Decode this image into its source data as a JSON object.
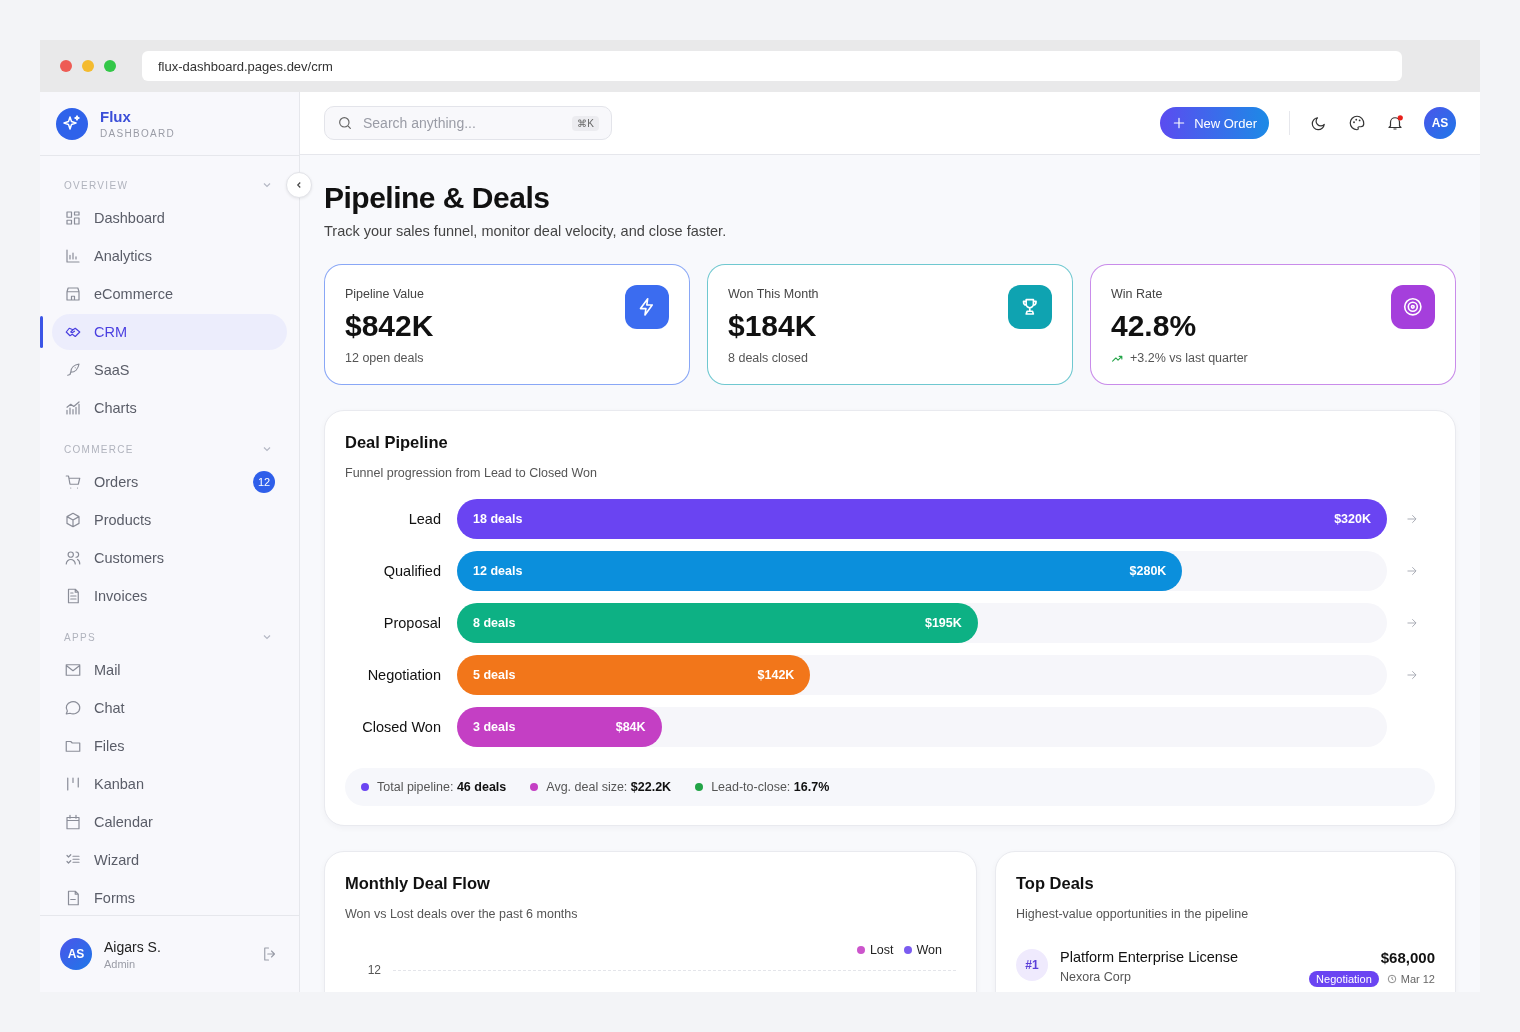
{
  "browser": {
    "url": "flux-dashboard.pages.dev/crm"
  },
  "brand": {
    "name": "Flux",
    "tagline": "DASHBOARD"
  },
  "sidebar": {
    "sections": [
      {
        "title": "OVERVIEW",
        "items": [
          {
            "label": "Dashboard",
            "selected": false
          },
          {
            "label": "Analytics",
            "selected": false
          },
          {
            "label": "eCommerce",
            "selected": false
          },
          {
            "label": "CRM",
            "selected": true
          },
          {
            "label": "SaaS",
            "selected": false
          },
          {
            "label": "Charts",
            "selected": false
          }
        ]
      },
      {
        "title": "COMMERCE",
        "items": [
          {
            "label": "Orders",
            "selected": false,
            "badge": "12"
          },
          {
            "label": "Products",
            "selected": false
          },
          {
            "label": "Customers",
            "selected": false
          },
          {
            "label": "Invoices",
            "selected": false
          }
        ]
      },
      {
        "title": "APPS",
        "items": [
          {
            "label": "Mail",
            "selected": false
          },
          {
            "label": "Chat",
            "selected": false
          },
          {
            "label": "Files",
            "selected": false
          },
          {
            "label": "Kanban",
            "selected": false
          },
          {
            "label": "Calendar",
            "selected": false
          },
          {
            "label": "Wizard",
            "selected": false
          },
          {
            "label": "Forms",
            "selected": false
          }
        ]
      }
    ],
    "user": {
      "initials": "AS",
      "name": "Aigars S.",
      "role": "Admin"
    }
  },
  "header": {
    "search": {
      "placeholder": "Search anything...",
      "shortcut": "⌘K"
    },
    "new_button": "New Order",
    "has_notification": true,
    "avatar": "AS"
  },
  "page": {
    "title": "Pipeline & Deals",
    "subtitle": "Track your sales funnel, monitor deal velocity, and close faster."
  },
  "kpis": [
    {
      "label": "Pipeline Value",
      "value": "$842K",
      "note": "12 open deals",
      "trend": false,
      "color": "#3b6cf0"
    },
    {
      "label": "Won This Month",
      "value": "$184K",
      "note": "8 deals closed",
      "trend": false,
      "color": "#0fa3b1"
    },
    {
      "label": "Win Rate",
      "value": "42.8%",
      "note": "+3.2% vs last quarter",
      "trend": true,
      "color": "#a53fdc"
    }
  ],
  "pipeline": {
    "title": "Deal Pipeline",
    "subtitle": "Funnel progression from Lead to Closed Won",
    "stages": [
      {
        "name": "Lead",
        "deals": "18 deals",
        "amount": "$320K",
        "level": 1.0,
        "color": "#6a44f2",
        "arrow": true
      },
      {
        "name": "Qualified",
        "deals": "12 deals",
        "amount": "$280K",
        "level": 0.78,
        "color": "#0b8fdc",
        "arrow": true
      },
      {
        "name": "Proposal",
        "deals": "8 deals",
        "amount": "$195K",
        "level": 0.56,
        "color": "#0db184",
        "arrow": true
      },
      {
        "name": "Negotiation",
        "deals": "5 deals",
        "amount": "$142K",
        "level": 0.38,
        "color": "#f2761a",
        "arrow": true
      },
      {
        "name": "Closed Won",
        "deals": "3 deals",
        "amount": "$84K",
        "level": 0.22,
        "color": "#c43fc4",
        "arrow": false
      }
    ],
    "summary": [
      {
        "text": "Total pipeline: **46 deals**",
        "color": "#6a44f2"
      },
      {
        "text": "Avg. deal size: **$22.2K**",
        "color": "#c43fc4"
      },
      {
        "text": "Lead-to-close: **16.7%**",
        "color": "#22a447"
      }
    ]
  },
  "deal_flow": {
    "title": "Monthly Deal Flow",
    "subtitle": "Won vs Lost deals over the past 6 months",
    "legend": [
      {
        "label": "Lost",
        "color": "#cc55cc"
      },
      {
        "label": "Won",
        "color": "#7b5cf0"
      }
    ],
    "y_tick": "12"
  },
  "top_deals": {
    "title": "Top Deals",
    "subtitle": "Highest-value opportunities in the pipeline",
    "rows": [
      {
        "rank": "#1",
        "name": "Platform Enterprise License",
        "company": "Nexora Corp",
        "amount": "$68,000",
        "stage": "Negotiation",
        "date": "Mar 12"
      }
    ]
  }
}
